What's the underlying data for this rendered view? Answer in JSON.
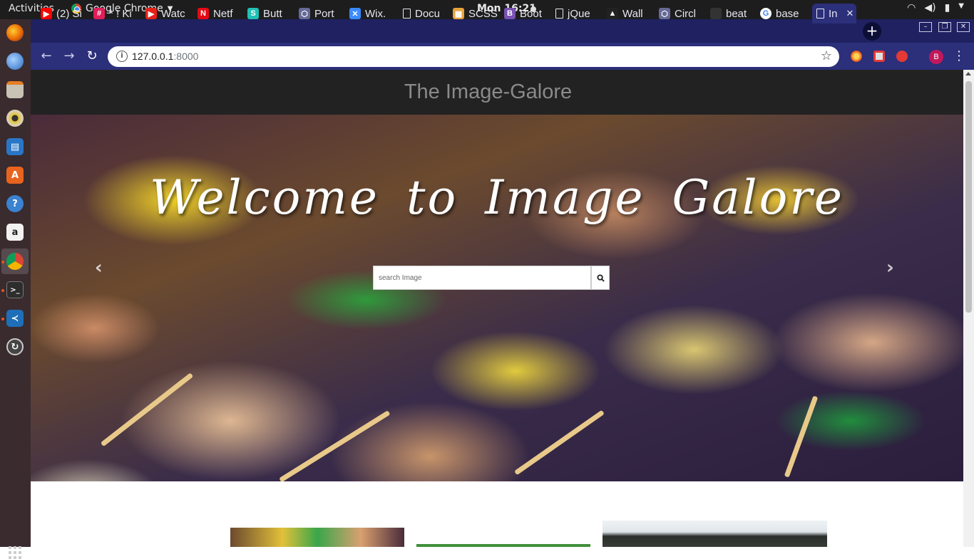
{
  "topbar": {
    "activities": "Activities",
    "app_name": "Google Chrome",
    "clock": "Mon 16:21"
  },
  "browser": {
    "tabs": [
      {
        "label": "(2) Si",
        "icon": "youtube-icon",
        "color": "#ff0000"
      },
      {
        "label": "* ! Ki",
        "icon": "slack-icon",
        "color": "#e01e5a"
      },
      {
        "label": "Watc",
        "icon": "play-icon",
        "color": "#e62117"
      },
      {
        "label": "Netf",
        "icon": "netflix-icon",
        "color": "#e50914"
      },
      {
        "label": "Butt",
        "icon": "s-icon",
        "color": "#20c1b5"
      },
      {
        "label": "Port",
        "icon": "hexagon-icon",
        "color": "#666a96"
      },
      {
        "label": "Wix.",
        "icon": "x-icon",
        "color": "#3b8bff"
      },
      {
        "label": "Docu",
        "icon": "document-icon",
        "color": "#ffffff"
      },
      {
        "label": "SCSS",
        "icon": "sass-icon",
        "color": "#e8a33e"
      },
      {
        "label": "Boot",
        "icon": "bootstrap-icon",
        "color": "#7952b3"
      },
      {
        "label": "jQue",
        "icon": "document-icon",
        "color": "#ffffff"
      },
      {
        "label": "Wall",
        "icon": "wallpaper-icon",
        "color": "#222222"
      },
      {
        "label": "Circl",
        "icon": "hexagon-icon",
        "color": "#666a96"
      },
      {
        "label": "beat",
        "icon": "blank-icon",
        "color": "#333333"
      },
      {
        "label": "base",
        "icon": "google-icon",
        "color": "#ffffff"
      },
      {
        "label": "In",
        "icon": "document-icon",
        "color": "#ffffff",
        "active": true
      }
    ],
    "new_tab": "+",
    "url_host": "127.0.0.1",
    "url_port": ":8000",
    "profile_initial": "B"
  },
  "site": {
    "title": "The Image-Galore",
    "welcome": "Welcome to Image Galore",
    "search_placeholder": "search Image",
    "carousel_prev": "‹",
    "carousel_next": "›"
  },
  "colors": {
    "tabstrip": "#1f2160",
    "toolbar": "#2c2f7a",
    "site_header": "#222222",
    "title_text": "#8a8a8a"
  }
}
